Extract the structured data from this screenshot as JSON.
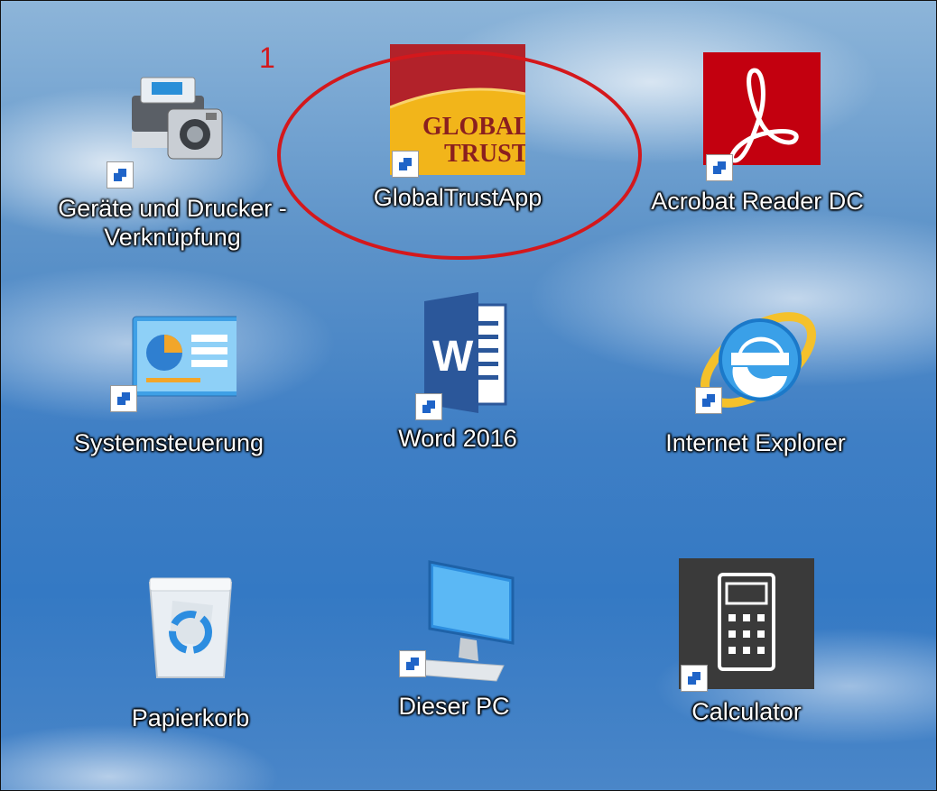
{
  "annotation": {
    "number": "1"
  },
  "icons": [
    {
      "label": "Geräte und Drucker - Verknüpfung",
      "icon": "printer-camera-icon"
    },
    {
      "label": "GlobalTrustApp",
      "icon": "globaltrust-logo-icon",
      "logo_lines": [
        "GLOBAL",
        "TRUST"
      ]
    },
    {
      "label": "Acrobat Reader DC",
      "icon": "acrobat-reader-icon"
    },
    {
      "label": "Systemsteuerung",
      "icon": "control-panel-icon"
    },
    {
      "label": "Word 2016",
      "icon": "word-icon",
      "glyph": "W"
    },
    {
      "label": "Internet Explorer",
      "icon": "internet-explorer-icon"
    },
    {
      "label": "Papierkorb",
      "icon": "recycle-bin-icon"
    },
    {
      "label": "Dieser PC",
      "icon": "monitor-icon"
    },
    {
      "label": "Calculator",
      "icon": "calculator-icon"
    }
  ],
  "colors": {
    "annotation": "#d4181c",
    "acrobat": "#c3000f",
    "word": "#2b579a",
    "calculator": "#3a3a3a"
  }
}
